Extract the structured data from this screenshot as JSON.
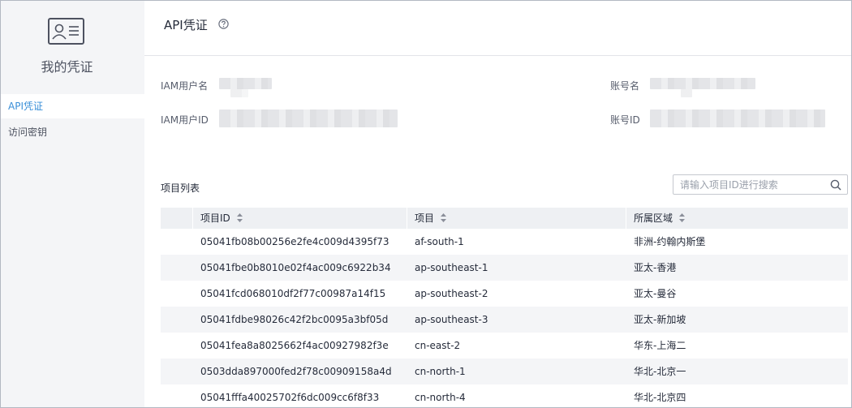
{
  "sidebar": {
    "title": "我的凭证",
    "items": [
      {
        "label": "API凭证",
        "active": true
      },
      {
        "label": "访问密钥",
        "active": false
      }
    ]
  },
  "header": {
    "title": "API凭证",
    "help_icon": "help-circle-icon"
  },
  "info": {
    "iam_user_name_label": "IAM用户名",
    "iam_user_id_label": "IAM用户ID",
    "account_name_label": "账号名",
    "account_id_label": "账号ID"
  },
  "projects": {
    "title": "项目列表",
    "search_placeholder": "请输入项目ID进行搜索",
    "search_value": "",
    "columns": [
      "项目ID",
      "项目",
      "所属区域"
    ],
    "rows": [
      [
        "05041fb08b00256e2fe4c009d4395f73",
        "af-south-1",
        "非洲-约翰内斯堡"
      ],
      [
        "05041fbe0b8010e02f4ac009c6922b34",
        "ap-southeast-1",
        "亚太-香港"
      ],
      [
        "05041fcd068010df2f77c00987a14f15",
        "ap-southeast-2",
        "亚太-曼谷"
      ],
      [
        "05041fdbe98026c42f2bc0095a3bf05d",
        "ap-southeast-3",
        "亚太-新加坡"
      ],
      [
        "05041fea8a8025662f4ac00927982f3e",
        "cn-east-2",
        "华东-上海二"
      ],
      [
        "0503dda897000fed2f78c00909158a4d",
        "cn-north-1",
        "华北-北京一"
      ],
      [
        "05041fffa40025702f6dc009cc6f8f33",
        "cn-north-4",
        "华北-北京四"
      ]
    ]
  },
  "colors": {
    "accent": "#3a8fd8",
    "sidebar_bg": "#f4f5f7",
    "header_bg": "#eef0f3"
  }
}
